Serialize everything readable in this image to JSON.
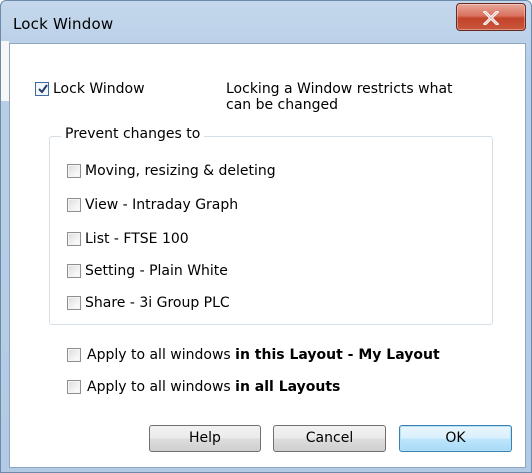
{
  "window": {
    "title": "Lock Window"
  },
  "lock": {
    "label": "Lock Window",
    "checked": true,
    "description": "Locking a Window restricts what can be changed"
  },
  "group": {
    "legend": "Prevent changes to",
    "items": [
      {
        "label": "Moving, resizing & deleting",
        "checked": false
      },
      {
        "label": "View - Intraday Graph",
        "checked": false
      },
      {
        "label": "List - FTSE 100",
        "checked": false
      },
      {
        "label": "Setting - Plain White",
        "checked": false
      },
      {
        "label": "Share - 3i Group PLC",
        "checked": false
      }
    ]
  },
  "apply": {
    "this_layout_prefix": "Apply to all windows ",
    "this_layout_bold": "in this Layout - My Layout",
    "all_layouts_prefix": "Apply to all windows ",
    "all_layouts_bold": "in all Layouts"
  },
  "buttons": {
    "help": "Help",
    "cancel": "Cancel",
    "ok": "OK"
  }
}
